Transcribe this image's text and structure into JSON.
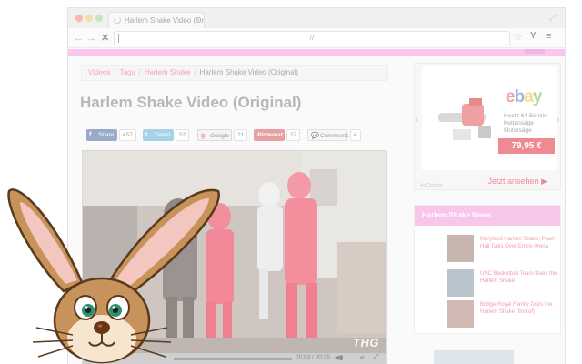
{
  "browser": {
    "tab_title": "Harlem Shake Video (Original)",
    "tab_close_glyph": "×",
    "url": "//"
  },
  "breadcrumb": {
    "items": [
      "Videos",
      "Tags",
      "Harlem Shake"
    ],
    "current": "Harlem Shake Video (Original)",
    "separator": "/"
  },
  "page": {
    "title": "Harlem Shake Video (Original)"
  },
  "share": {
    "facebook": {
      "label": "Share",
      "count": "457"
    },
    "twitter": {
      "label": "Tweet",
      "count": "52"
    },
    "google": {
      "label": "Google",
      "count": "21"
    },
    "pinterest": {
      "label": "Pinterest",
      "count": "27"
    },
    "comments": {
      "label": "Comments",
      "count": "4"
    }
  },
  "video": {
    "time": "00:03 / 00:35",
    "watermark": "THG"
  },
  "ad": {
    "logo_letters": [
      "e",
      "b",
      "a",
      "y"
    ],
    "text": "Hecht 64 Benzin Kettensäge Motorsäge",
    "price": "79,95 €",
    "cta": "Jetzt ansehen ▶",
    "footer": "AdChoices"
  },
  "news": {
    "heading": "Harlem Shake News",
    "items": [
      {
        "text": "Maryland Harlem Shake: Pearl Hall Talks Over Entire Arena"
      },
      {
        "text": "UNC Basketball Team Does the Harlem Shake"
      },
      {
        "text": "Bridge Royal Family Does the Harlem Shake (first of)"
      }
    ]
  },
  "colors": {
    "accent_pink": "#f8c6e9",
    "link_pink": "#f4a3c3",
    "price_red": "#f08a92"
  },
  "icons": {
    "back": "arrow-left-icon",
    "forward": "arrow-right-icon",
    "stop": "stop-x-icon",
    "star": "star-icon",
    "menu": "hamburger-icon"
  }
}
